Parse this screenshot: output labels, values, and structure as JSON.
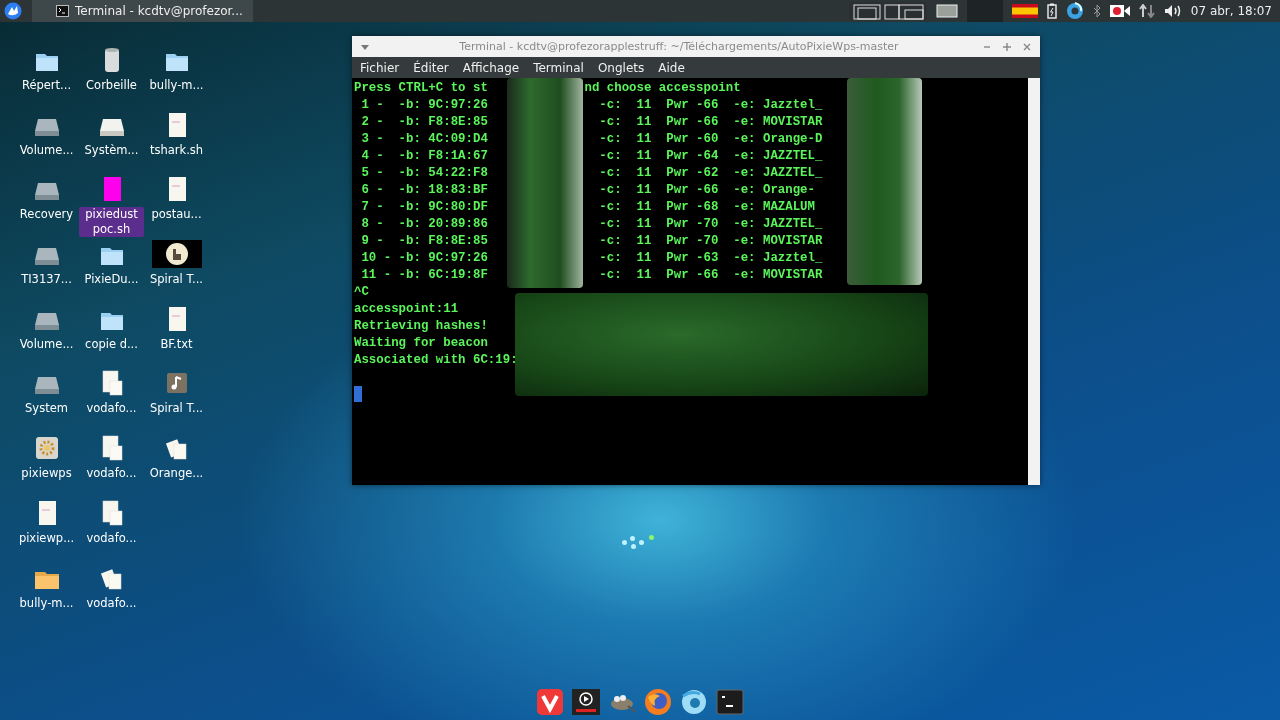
{
  "top_panel": {
    "task": {
      "title": "Terminal - kcdtv@profezor...",
      "selected": true
    },
    "clock": "07 abr, 18:07"
  },
  "desktop_icons": [
    {
      "label": "Répert...",
      "kind": "folder",
      "selected": false
    },
    {
      "label": "Volume...",
      "kind": "drive",
      "selected": false
    },
    {
      "label": "Recovery",
      "kind": "drive",
      "selected": false
    },
    {
      "label": "TI3137...",
      "kind": "drive",
      "selected": false
    },
    {
      "label": "Volume...",
      "kind": "drive",
      "selected": false
    },
    {
      "label": "System",
      "kind": "drive",
      "selected": false
    },
    {
      "label": "pixiewps",
      "kind": "gear",
      "selected": false
    },
    {
      "label": "pixiewp...",
      "kind": "document",
      "selected": false
    },
    {
      "label": "bully-m...",
      "kind": "archive",
      "selected": false
    },
    {
      "label": "Corbeille",
      "kind": "trash",
      "selected": false
    },
    {
      "label": "Systèm...",
      "kind": "drive-light",
      "selected": false
    },
    {
      "label": "pixiedust poc.sh",
      "kind": "script",
      "selected": true
    },
    {
      "label": "PixieDu...",
      "kind": "folder",
      "selected": false
    },
    {
      "label": "copie d...",
      "kind": "folder",
      "selected": false
    },
    {
      "label": "vodafo...",
      "kind": "pair",
      "selected": false
    },
    {
      "label": "vodafo...",
      "kind": "pair",
      "selected": false
    },
    {
      "label": "vodafo...",
      "kind": "pair",
      "selected": false
    },
    {
      "label": "vodafo...",
      "kind": "stack",
      "selected": false
    },
    {
      "label": "bully-m...",
      "kind": "folder",
      "selected": false
    },
    {
      "label": "tshark.sh",
      "kind": "document",
      "selected": false
    },
    {
      "label": "postau...",
      "kind": "document",
      "selected": false
    },
    {
      "label": "Spiral T...",
      "selected": false
    },
    {
      "label": "BF.txt",
      "kind": "document",
      "selected": false
    },
    {
      "label": "Spiral T...",
      "kind": "audio",
      "selected": false
    },
    {
      "label": "Orange...",
      "kind": "stack",
      "selected": false
    }
  ],
  "terminal": {
    "title": "Terminal - kcdtv@profezorapplestruff: ~/Téléchargements/AutoPixieWps-master",
    "menu": [
      "Fichier",
      "Éditer",
      "Affichage",
      "Terminal",
      "Onglets",
      "Aide"
    ],
    "lines": [
      {
        "kind": "prompt",
        "left": "Press CTRL+C to st",
        "right": "nd choose accesspoint"
      },
      {
        "kind": "row",
        "left": " 1 -  -b: 9C:97:26",
        "right": "-c:  11  Pwr -66  -e: Jazztel_"
      },
      {
        "kind": "row",
        "left": " 2 -  -b: F8:8E:85",
        "right": "-c:  11  Pwr -66  -e: MOVISTAR"
      },
      {
        "kind": "row",
        "left": " 3 -  -b: 4C:09:D4",
        "right": "-c:  11  Pwr -60  -e: Orange-D"
      },
      {
        "kind": "row",
        "left": " 4 -  -b: F8:1A:67",
        "right": "-c:  11  Pwr -64  -e: JAZZTEL_"
      },
      {
        "kind": "row",
        "left": " 5 -  -b: 54:22:F8",
        "right": "-c:  11  Pwr -62  -e: JAZZTEL_"
      },
      {
        "kind": "row",
        "left": " 6 -  -b: 18:83:BF",
        "right": "-c:  11  Pwr -66  -e: Orange-"
      },
      {
        "kind": "row",
        "left": " 7 -  -b: 9C:80:DF",
        "right": "-c:  11  Pwr -68  -e: MAZALUM"
      },
      {
        "kind": "row",
        "left": " 8 -  -b: 20:89:86",
        "right": "-c:  11  Pwr -70  -e: JAZZTEL_"
      },
      {
        "kind": "row",
        "left": " 9 -  -b: F8:8E:85",
        "right": "-c:  11  Pwr -70  -e: MOVISTAR"
      },
      {
        "kind": "row",
        "left": " 10 - -b: 9C:97:26",
        "right": "-c:  11  Pwr -63  -e: Jazztel_"
      },
      {
        "kind": "row",
        "left": " 11 - -b: 6C:19:8F",
        "right": "-c:  11  Pwr -66  -e: MOVISTAR"
      },
      {
        "kind": "plain",
        "text": "^C"
      },
      {
        "kind": "plain",
        "text": "accesspoint:11"
      },
      {
        "kind": "plain",
        "text": "Retrieving hashes!"
      },
      {
        "kind": "plain",
        "text": "Waiting for beacon"
      },
      {
        "kind": "plain",
        "text": "Associated with 6C:19:"
      }
    ]
  }
}
